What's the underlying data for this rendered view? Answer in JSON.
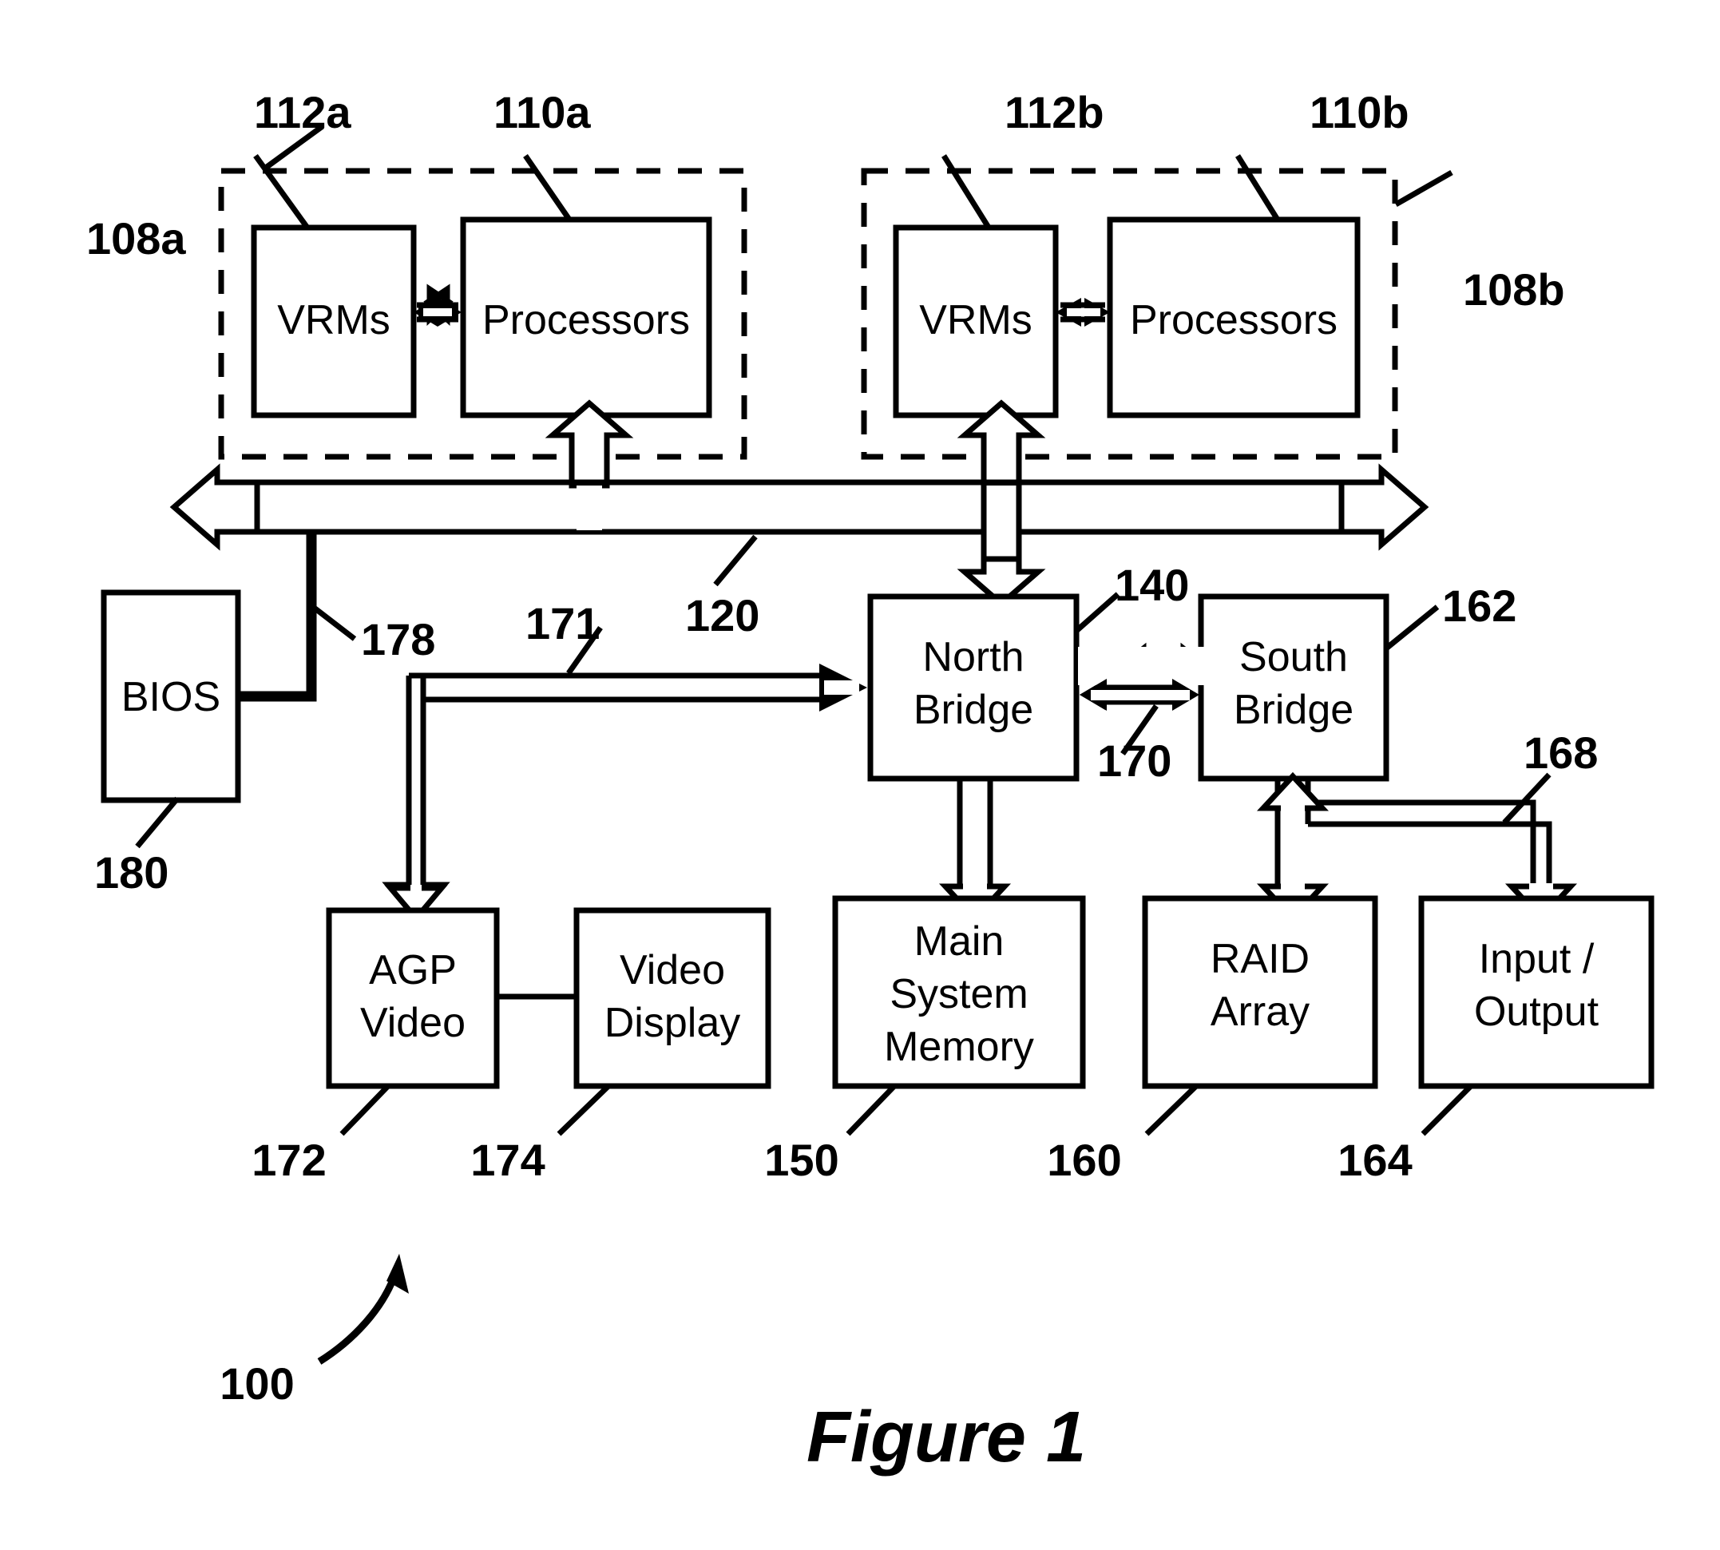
{
  "figure": {
    "caption": "Figure 1",
    "system_ref": "100"
  },
  "blocks": {
    "vrms_a": "VRMs",
    "processors_a": "Processors",
    "vrms_b": "VRMs",
    "processors_b": "Processors",
    "bios": "BIOS",
    "north_bridge_line1": "North",
    "north_bridge_line2": "Bridge",
    "south_bridge_line1": "South",
    "south_bridge_line2": "Bridge",
    "agp_line1": "AGP",
    "agp_line2": "Video",
    "video_display_line1": "Video",
    "video_display_line2": "Display",
    "memory_line1": "Main",
    "memory_line2": "System",
    "memory_line3": "Memory",
    "raid_line1": "RAID",
    "raid_line2": "Array",
    "io_line1": "Input /",
    "io_line2": "Output"
  },
  "refs": {
    "group_a": "108a",
    "group_b": "108b",
    "vrms_a": "112a",
    "processors_a": "110a",
    "vrms_b": "112b",
    "processors_b": "110b",
    "system_bus": "120",
    "bios_bus": "178",
    "bios": "180",
    "agp_bus": "171",
    "north_bridge": "140",
    "bridge_bus": "170",
    "south_bridge": "162",
    "io_bus": "168",
    "agp_video": "172",
    "video_display": "174",
    "memory": "150",
    "raid": "160",
    "io": "164"
  },
  "chart_data": {
    "type": "diagram",
    "title": "Figure 1",
    "nodes": [
      {
        "id": "112a",
        "label": "VRMs",
        "group": "108a"
      },
      {
        "id": "110a",
        "label": "Processors",
        "group": "108a"
      },
      {
        "id": "112b",
        "label": "VRMs",
        "group": "108b"
      },
      {
        "id": "110b",
        "label": "Processors",
        "group": "108b"
      },
      {
        "id": "180",
        "label": "BIOS"
      },
      {
        "id": "140",
        "label": "North Bridge"
      },
      {
        "id": "162",
        "label": "South Bridge"
      },
      {
        "id": "172",
        "label": "AGP Video"
      },
      {
        "id": "174",
        "label": "Video Display"
      },
      {
        "id": "150",
        "label": "Main System Memory"
      },
      {
        "id": "160",
        "label": "RAID Array"
      },
      {
        "id": "164",
        "label": "Input / Output"
      }
    ],
    "edges": [
      {
        "from": "112a",
        "to": "110a",
        "style": "double-arrow"
      },
      {
        "from": "112b",
        "to": "110b",
        "style": "double-arrow"
      },
      {
        "from": "120",
        "to": "110a",
        "style": "hollow-arrow"
      },
      {
        "from": "120",
        "to": "110b",
        "style": "hollow-arrow"
      },
      {
        "from": "120",
        "to": "140",
        "style": "hollow-double-arrow"
      },
      {
        "from": "120",
        "to": "180",
        "style": "line",
        "ref": "178"
      },
      {
        "from": "140",
        "to": "162",
        "style": "hollow-double-arrow",
        "ref": "170"
      },
      {
        "from": "140",
        "to": "172",
        "style": "hollow-arrow",
        "ref": "171"
      },
      {
        "from": "140",
        "to": "150",
        "style": "hollow-double-arrow"
      },
      {
        "from": "172",
        "to": "174",
        "style": "line"
      },
      {
        "from": "162",
        "to": "160",
        "style": "hollow-double-arrow",
        "ref": "168"
      },
      {
        "from": "162",
        "to": "164",
        "style": "hollow-double-arrow",
        "ref": "168"
      }
    ]
  }
}
